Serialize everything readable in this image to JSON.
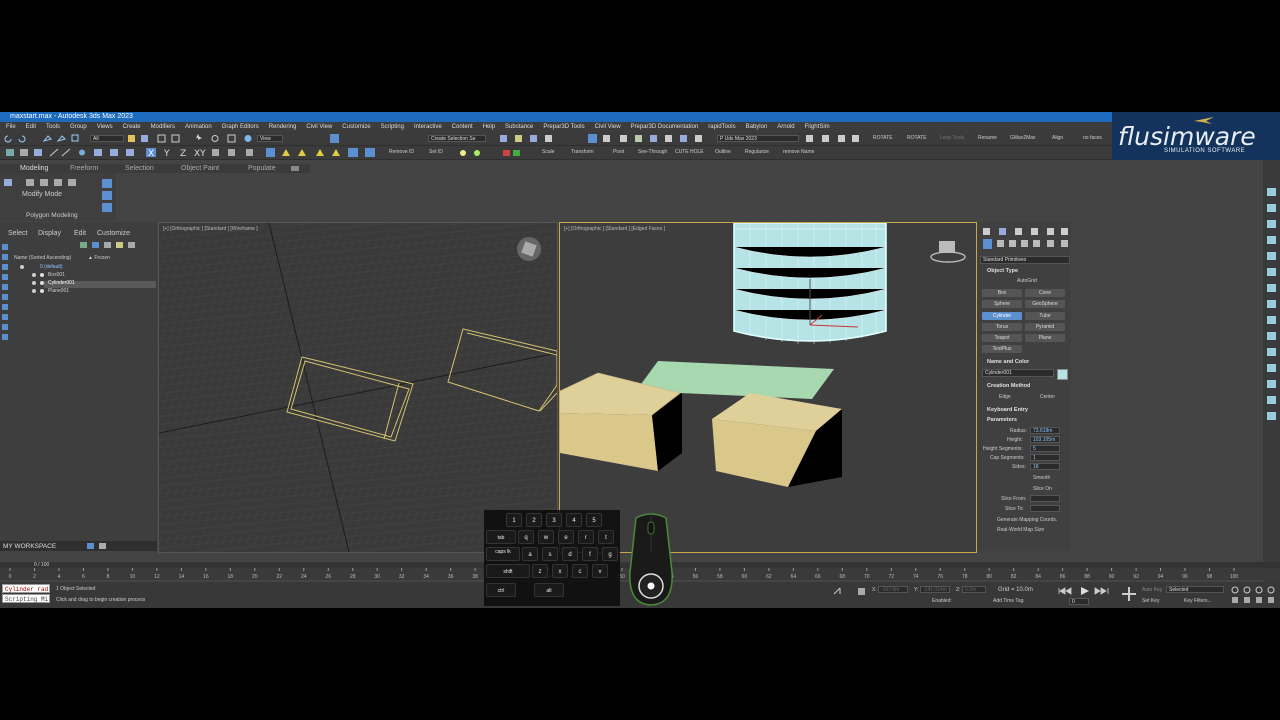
{
  "window": {
    "title": "maxstart.max - Autodesk 3ds Max 2023"
  },
  "menu": [
    "File",
    "Edit",
    "Tools",
    "Group",
    "Views",
    "Create",
    "Modifiers",
    "Animation",
    "Graph Editors",
    "Rendering",
    "Civil View",
    "Customize",
    "Scripting",
    "Interactive",
    "Content",
    "Help",
    "Substance",
    "Prepar3D Tools",
    "Civil View",
    "Prepar3D Documentation",
    "rapidTools",
    "Babylon",
    "Arnold",
    "FlightSim"
  ],
  "toolbar1": {
    "filter": "All",
    "view": "View",
    "selection_set": "Create Selection Se",
    "workspace_combo": "P Uds Max 2023",
    "labels": [
      "ROTATE",
      "ROTATE",
      "Loop Tools",
      "Rename",
      "GMax2Max",
      "Align",
      "no faces"
    ]
  },
  "toolbar2": {
    "labels": [
      "Remove ID",
      "Set ID",
      "Scale",
      "Transform",
      "Pivot",
      "See-Through",
      "CUTE HOLE",
      "Outline",
      "Regularize",
      "remove Name"
    ]
  },
  "logo": {
    "text": "flusimware",
    "tagline": "SIMULATION SOFTWARE"
  },
  "ribbon": {
    "tabs": [
      "Modeling",
      "Freeform",
      "Selection",
      "Object Paint",
      "Populate"
    ],
    "modify_mode": "Modify Mode",
    "polygon_modeling": "Polygon Modeling"
  },
  "scene_explorer": {
    "tabs": [
      "Select",
      "Display",
      "Edit",
      "Customize"
    ],
    "header_name": "Name (Sorted Ascending)",
    "header_frozen": "▲ Frozen",
    "items": [
      "0 (default)",
      "Box001",
      "Cylinder001",
      "Plane001"
    ]
  },
  "workspace": {
    "label": "MY WORKSPACE"
  },
  "viewports": {
    "left_label": "[+] [Orthographic ] [Standard ] [Wireframe ]",
    "right_label": "[+] [Orthographic ] [Standard ] [Edged Faces ]"
  },
  "command_panel": {
    "dropdown": "Standard Primitives",
    "object_type": "Object Type",
    "autogrid": "AutoGrid",
    "primitives": [
      "Box",
      "Cone",
      "Sphere",
      "GeoSphere",
      "Cylinder",
      "Tube",
      "Torus",
      "Pyramid",
      "Teapot",
      "Plane",
      "TextPlus"
    ],
    "active_primitive": "Cylinder",
    "name_color": "Name and Color",
    "object_name": "Cylinder001",
    "creation_method": "Creation Method",
    "edge": "Edge",
    "center": "Center",
    "keyboard_entry": "Keyboard Entry",
    "parameters": "Parameters",
    "params": [
      {
        "label": "Radius:",
        "value": "73.619m"
      },
      {
        "label": "Height:",
        "value": "103.105m"
      },
      {
        "label": "Height Segments:",
        "value": "5"
      },
      {
        "label": "Cap Segments:",
        "value": "1"
      },
      {
        "label": "Sides:",
        "value": "18"
      }
    ],
    "smooth": "Smooth",
    "slice_on": "Slice On",
    "slice_from": "Slice From:",
    "slice_to": "Slice To:",
    "gen_mapping": "Generate Mapping Coords.",
    "real_world": "Real-World Map Size"
  },
  "timeline": {
    "frame": "0 / 100",
    "ticks": [
      "0",
      "2",
      "4",
      "6",
      "8",
      "10",
      "12",
      "14",
      "16",
      "18",
      "20",
      "22",
      "24",
      "26",
      "28",
      "30",
      "32",
      "34",
      "36",
      "38",
      "40",
      "42",
      "44",
      "46",
      "48",
      "50",
      "52",
      "54",
      "56",
      "58",
      "60",
      "62",
      "64",
      "66",
      "68",
      "70",
      "72",
      "74",
      "76",
      "78",
      "80",
      "82",
      "84",
      "86",
      "88",
      "90",
      "92",
      "94",
      "96",
      "98",
      "100"
    ]
  },
  "status": {
    "maxscript_top": "Cylinder rad",
    "maxscript_bottom": "Scripting Mi",
    "selected": "1 Object Selected",
    "prompt": "Click and drag to begin creation process",
    "x_label": "X:",
    "x_value": "-167.0m",
    "y_label": "Y:",
    "y_value": "-141.014m",
    "z_label": "Z:",
    "z_value": "0.0m",
    "grid": "Grid = 10.0m",
    "enabled": "Enabled:",
    "add_time_tag": "Add Time Tag",
    "auto_key": "Auto Key",
    "set_key": "Set Key",
    "selected_combo": "Selected",
    "key_filters": "Key Filters...",
    "frame_field": "0"
  },
  "keyboard_overlay": {
    "numbers": [
      "1",
      "2",
      "3",
      "4",
      "5"
    ],
    "row1": [
      "tab",
      "q",
      "w",
      "e",
      "r",
      "t"
    ],
    "row2": [
      "caps lk",
      "a",
      "s",
      "d",
      "f",
      "g"
    ],
    "row3": [
      "shift",
      "z",
      "x",
      "c",
      "v"
    ],
    "row4": [
      "ctrl",
      "alt"
    ]
  },
  "colors": {
    "accent": "#5b8fcf",
    "selection": "#c9a74c",
    "title_bar": "#1c6bbf",
    "logo_bg": "#14335c"
  }
}
